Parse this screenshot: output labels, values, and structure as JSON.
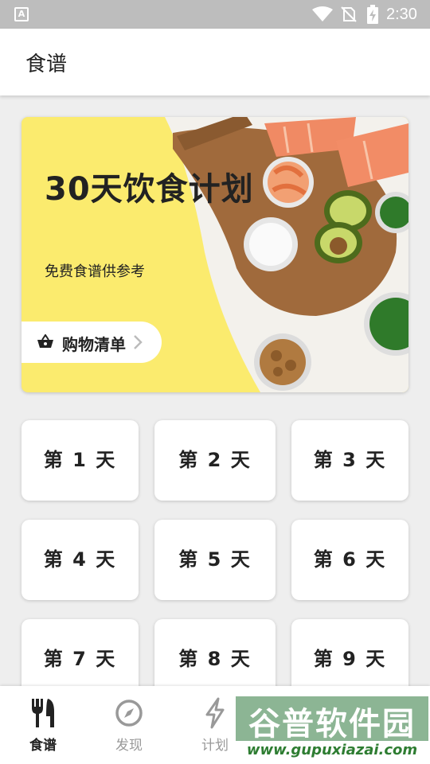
{
  "status_bar": {
    "left_icon_letter": "A",
    "time": "2:30"
  },
  "app_bar": {
    "title": "食谱"
  },
  "banner": {
    "title": "30天饮食计划",
    "subtitle": "免费食谱供参考",
    "shopping_button_label": "购物清单",
    "icons": {
      "basket": "basket-icon",
      "chevron": "chevron-right-icon"
    },
    "background_color": "#fbeb6e"
  },
  "days": [
    {
      "label": "第 1 天"
    },
    {
      "label": "第 2 天"
    },
    {
      "label": "第 3 天"
    },
    {
      "label": "第 4 天"
    },
    {
      "label": "第 5 天"
    },
    {
      "label": "第 6 天"
    },
    {
      "label": "第 7 天"
    },
    {
      "label": "第 8 天"
    },
    {
      "label": "第 9 天"
    }
  ],
  "bottom_nav": {
    "items": [
      {
        "label": "食谱",
        "icon": "utensils-icon",
        "active": true
      },
      {
        "label": "发现",
        "icon": "compass-icon",
        "active": false
      },
      {
        "label": "计划",
        "icon": "lightning-icon",
        "active": false
      }
    ]
  },
  "watermark": {
    "title": "谷普软件园",
    "url": "www.gupuxiazai.com"
  }
}
